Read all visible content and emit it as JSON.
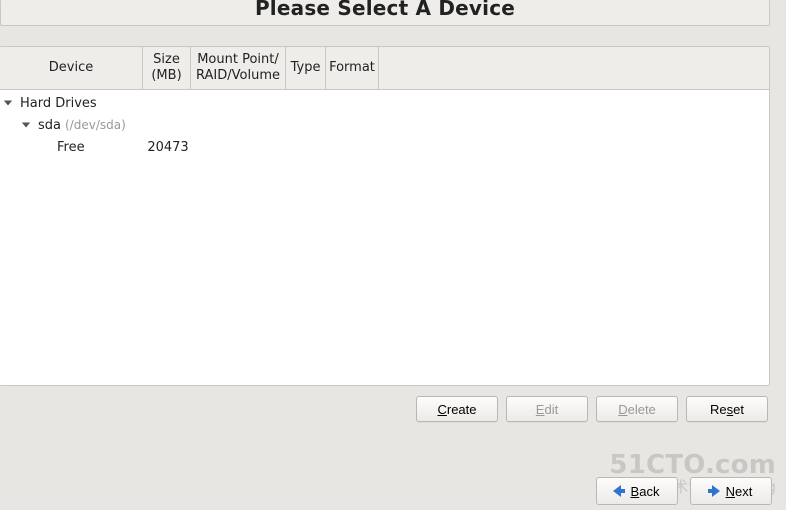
{
  "header": {
    "title": "Please Select A Device"
  },
  "columns": {
    "device": "Device",
    "size_line1": "Size",
    "size_line2": "(MB)",
    "mount_line1": "Mount Point/",
    "mount_line2": "RAID/Volume",
    "type": "Type",
    "format": "Format"
  },
  "tree": {
    "root_label": "Hard Drives",
    "disk_label": "sda",
    "disk_path": "(/dev/sda)",
    "free_label": "Free",
    "free_size": "20473"
  },
  "buttons": {
    "create_pre": "",
    "create_u": "C",
    "create_post": "reate",
    "edit_pre": "",
    "edit_u": "E",
    "edit_post": "dit",
    "delete_pre": "",
    "delete_u": "D",
    "delete_post": "elete",
    "reset_pre": "Re",
    "reset_u": "s",
    "reset_post": "et",
    "back_pre": "",
    "back_u": "B",
    "back_post": "ack",
    "next_pre": "",
    "next_u": "N",
    "next_post": "ext"
  },
  "watermark": {
    "line1": "51CTO.com",
    "line2": "技术博客 — Blog"
  }
}
